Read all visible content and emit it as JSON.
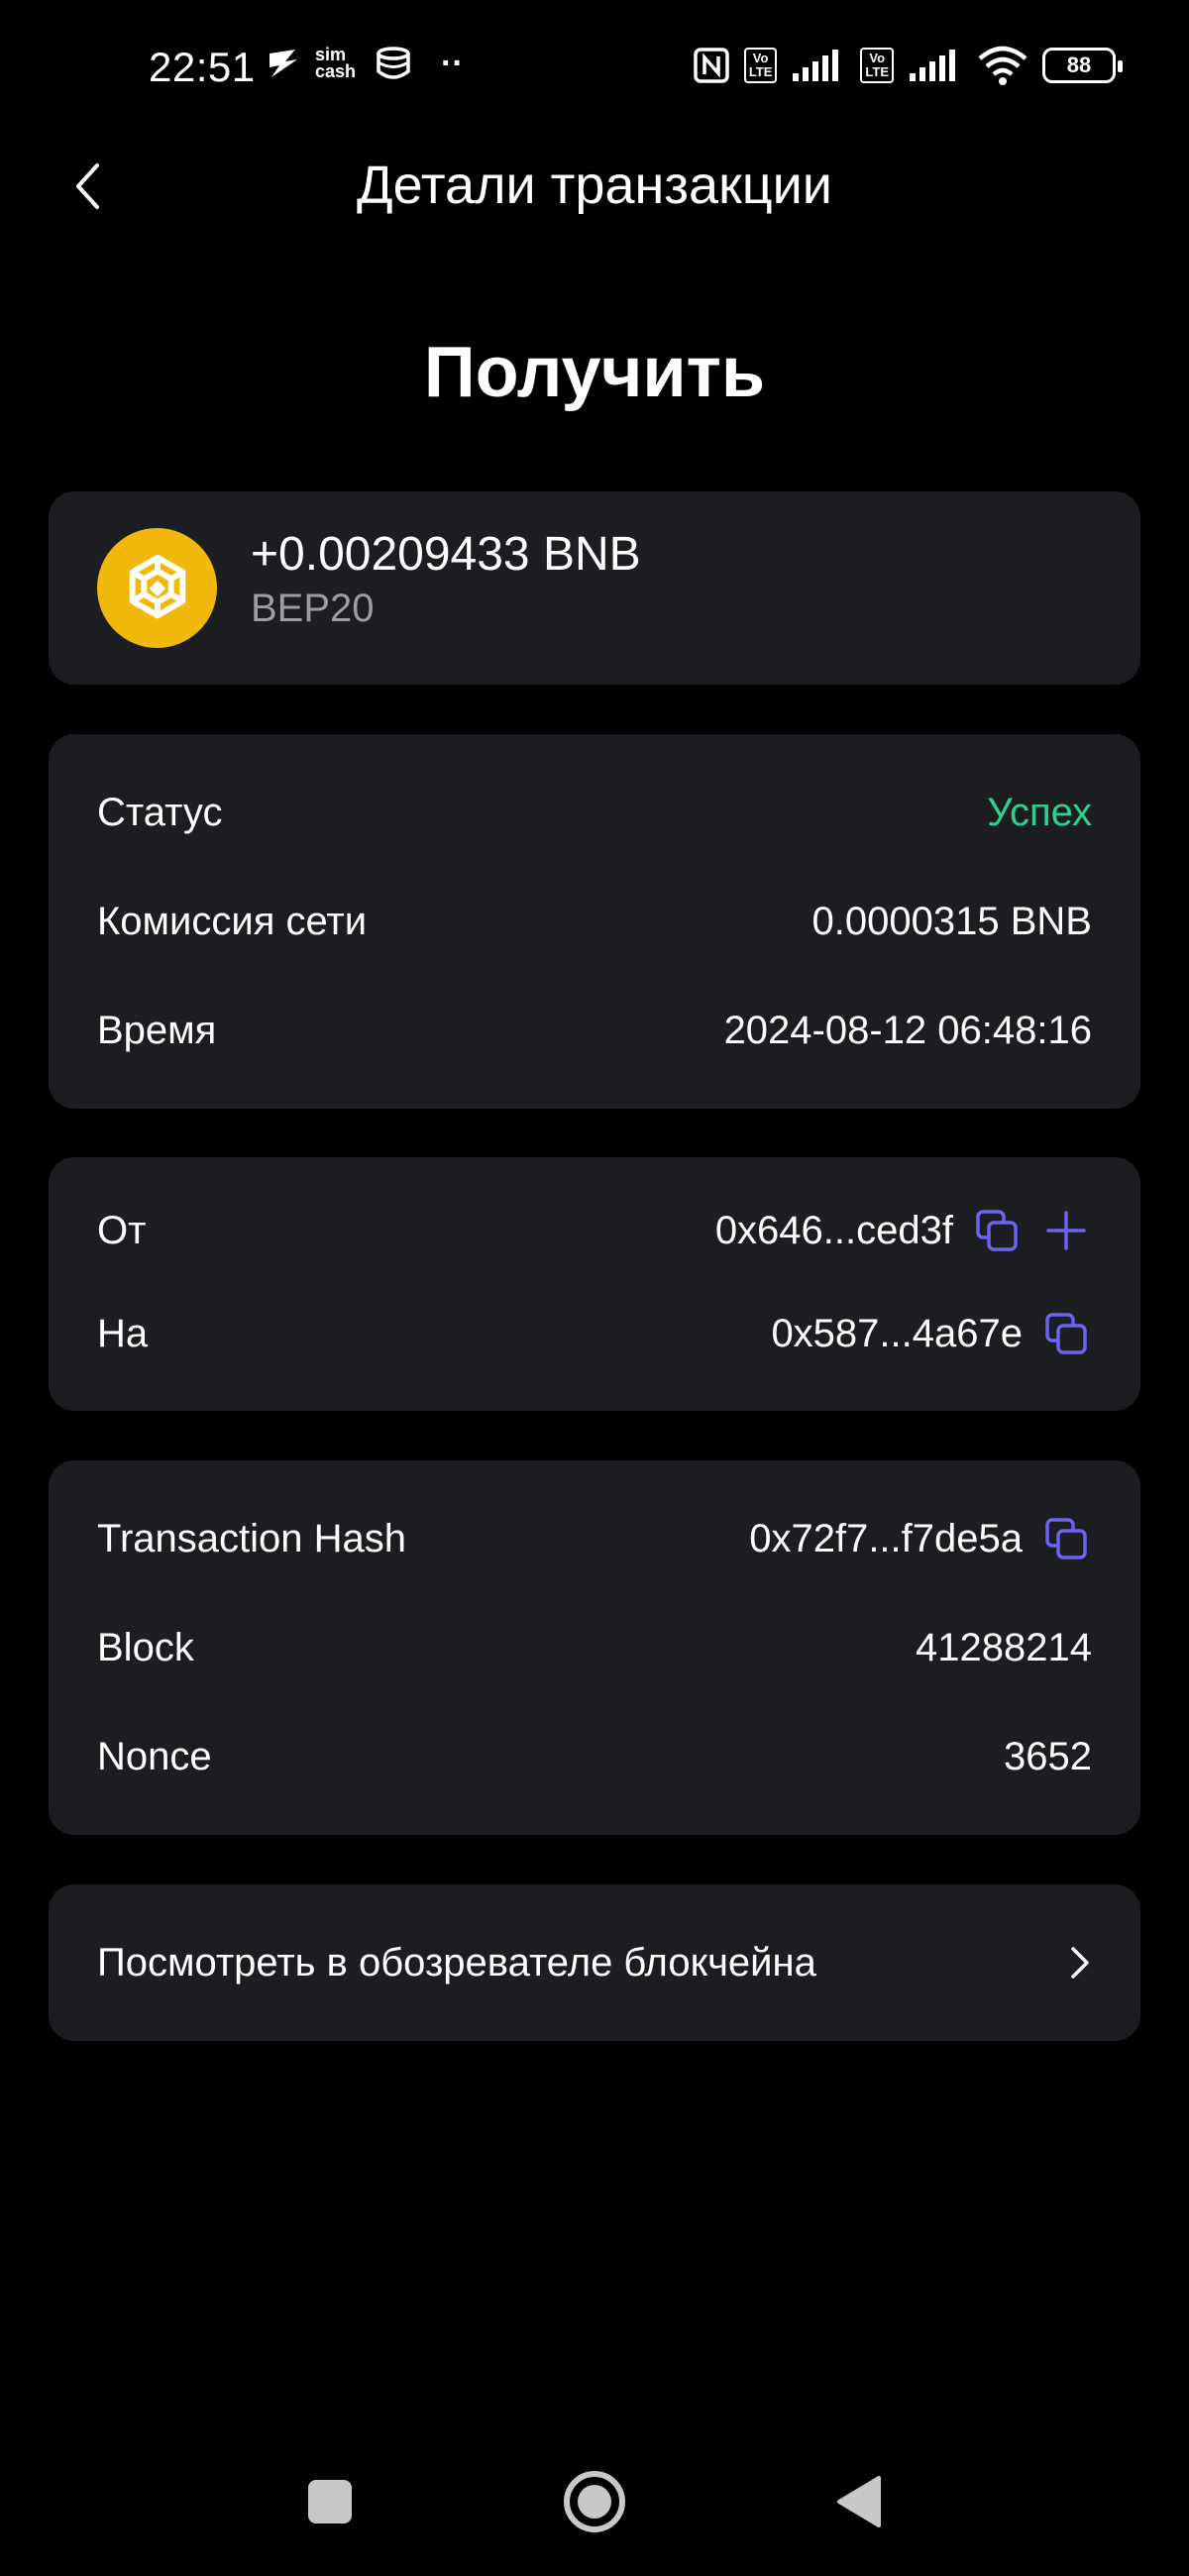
{
  "status_bar": {
    "time": "22:51",
    "sim_label_top": "sim",
    "sim_label_bottom": "cash",
    "dots": "··",
    "volte_top": "Vo",
    "volte_bottom": "LTE",
    "battery": "88"
  },
  "header": {
    "title": "Детали транзакции"
  },
  "page": {
    "title": "Получить"
  },
  "amount_card": {
    "amount": "+0.00209433 BNB",
    "network": "BEP20",
    "coin_icon": "bnb-icon"
  },
  "details": {
    "status_label": "Статус",
    "status_value": "Успех",
    "fee_label": "Комиссия сети",
    "fee_value": "0.0000315 BNB",
    "time_label": "Время",
    "time_value": "2024-08-12 06:48:16"
  },
  "addresses": {
    "from_label": "От",
    "from_value": "0x646...ced3f",
    "to_label": "На",
    "to_value": "0x587...4a67e"
  },
  "chain": {
    "hash_label": "Transaction Hash",
    "hash_value": "0x72f7...f7de5a",
    "block_label": "Block",
    "block_value": "41288214",
    "nonce_label": "Nonce",
    "nonce_value": "3652"
  },
  "explorer": {
    "label": "Посмотреть в обозревателе блокчейна"
  },
  "colors": {
    "background": "#000000",
    "card": "#1c1d20",
    "accent": "#6b63f0",
    "success": "#2fd18d",
    "bnb_yellow": "#f0b90b",
    "muted": "#9b9ca4"
  }
}
